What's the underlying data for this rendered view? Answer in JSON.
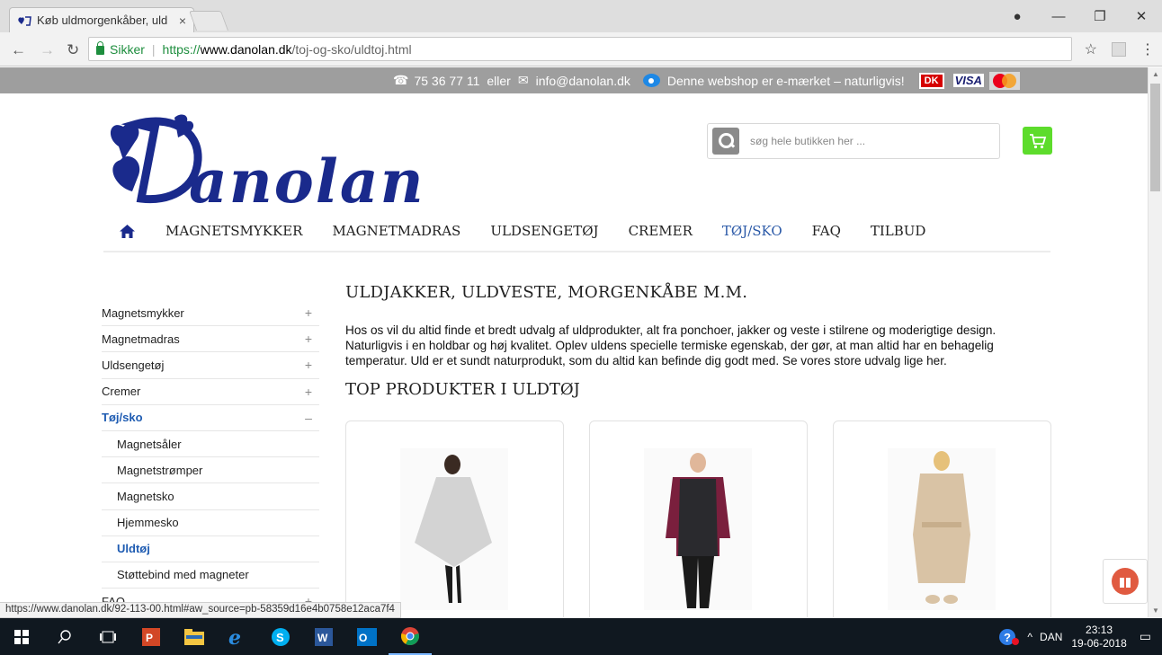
{
  "browser": {
    "tab_title": "Køb uldmorgenkåber, uld",
    "secure_label": "Sikker",
    "url_scheme": "https://",
    "url_host": "www.danolan.dk",
    "url_path": "/toj-og-sko/uldtoj.html"
  },
  "topstrip": {
    "phone": "75 36 77 11",
    "or_label": "eller",
    "email": "info@danolan.dk",
    "emark_text": "Denne webshop er e-mærket – naturligvis!",
    "dk_label": "DK",
    "visa_label": "VISA"
  },
  "logo": {
    "text": "anolan"
  },
  "search": {
    "placeholder": "søg hele butikken her ..."
  },
  "nav": {
    "items": [
      {
        "label": "MAGNETSMYKKER"
      },
      {
        "label": "MAGNETMADRAS"
      },
      {
        "label": "ULDSENGETØJ"
      },
      {
        "label": "CREMER"
      },
      {
        "label": "TØJ/SKO"
      },
      {
        "label": "FAQ"
      },
      {
        "label": "TILBUD"
      }
    ]
  },
  "sidebar": {
    "items": [
      {
        "label": "Magnetsmykker",
        "toggle": "+"
      },
      {
        "label": "Magnetmadras",
        "toggle": "+"
      },
      {
        "label": "Uldsengetøj",
        "toggle": "+"
      },
      {
        "label": "Cremer",
        "toggle": "+"
      },
      {
        "label": "Tøj/sko",
        "toggle": "–"
      },
      {
        "label": "Magnetsåler"
      },
      {
        "label": "Magnetstrømper"
      },
      {
        "label": "Magnetsko"
      },
      {
        "label": "Hjemmesko"
      },
      {
        "label": "Uldtøj"
      },
      {
        "label": "Støttebind med magneter"
      },
      {
        "label": "FAQ",
        "toggle": "+"
      }
    ]
  },
  "content": {
    "title": "ULDJAKKER, ULDVESTE, MORGENKÅBE M.M.",
    "description": "Hos os vil du altid finde et bredt udvalg af uldprodukter, alt fra ponchoer, jakker og veste i stilrene og moderigtige design. Naturligvis i en holdbar og høj kvalitet. Oplev uldens specielle termiske egenskab, der gør, at man altid har en behagelig temperatur. Uld er et sundt naturprodukt, som du altid kan befinde dig godt med. Se vores store udvalg lige her.",
    "subtitle": "TOP PRODUKTER I ULDTØJ"
  },
  "status_url": "https://www.danolan.dk/92-113-00.html#aw_source=pb-58359d16e4b0758e12aca7f4",
  "taskbar": {
    "language": "DAN",
    "time": "23:13",
    "date": "19-06-2018"
  },
  "colors": {
    "brand_blue": "#1a2a8c",
    "active_link": "#1f5cb2",
    "cart_green": "#5ddc2c",
    "topstrip_grey": "#9e9e9e"
  }
}
